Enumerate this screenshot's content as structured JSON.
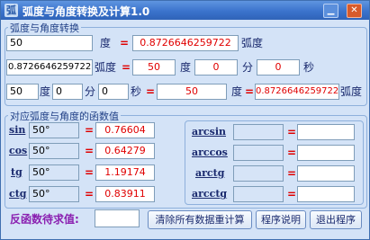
{
  "window": {
    "title": "弧度与角度转换及计算1.0",
    "icon_glyph": "弧",
    "min_icon": "minimize-icon",
    "close_icon": "close-icon",
    "min_glyph": "▁",
    "close_glyph": "✕"
  },
  "group1": {
    "title": "弧度与角度转换",
    "row1": {
      "degree_value": "50",
      "degree_label": "度",
      "eq": "=",
      "radian_value": "0.8726646259722",
      "radian_label": "弧度"
    },
    "row2": {
      "radian_value": "0.8726646259722",
      "radian_label": "弧度",
      "eq": "=",
      "deg": "50",
      "deg_label": "度",
      "min": "0",
      "min_label": "分",
      "sec": "0",
      "sec_label": "秒"
    },
    "row3": {
      "deg": "50",
      "deg_label": "度",
      "min": "0",
      "min_label": "分",
      "sec": "0",
      "sec_label": "秒",
      "eq": "=",
      "total_deg": "50",
      "total_deg_label": "度",
      "eq2": "=",
      "radian_value": "0.8726646259722",
      "radian_label": "弧度"
    }
  },
  "group2": {
    "title": "对应弧度与角度的函数值",
    "trig": [
      {
        "fn": "sin",
        "angle": "50°",
        "eq": "=",
        "value": "0.76604"
      },
      {
        "fn": "cos",
        "angle": "50°",
        "eq": "=",
        "value": "0.64279"
      },
      {
        "fn": "tg",
        "angle": "50°",
        "eq": "=",
        "value": "1.19174"
      },
      {
        "fn": "ctg",
        "angle": "50°",
        "eq": "=",
        "value": "0.83911"
      }
    ],
    "inverse": [
      {
        "fn": "arcsin",
        "eq": "=",
        "value": ""
      },
      {
        "fn": "arccos",
        "eq": "=",
        "value": ""
      },
      {
        "fn": "arctg",
        "eq": "=",
        "value": ""
      },
      {
        "fn": "arcctg",
        "eq": "=",
        "value": ""
      }
    ]
  },
  "bottom": {
    "inverse_label": "反函数待求值:",
    "inverse_value": "",
    "clear_button": "清除所有数据重计算",
    "help_button": "程序说明",
    "exit_button": "退出程序"
  }
}
